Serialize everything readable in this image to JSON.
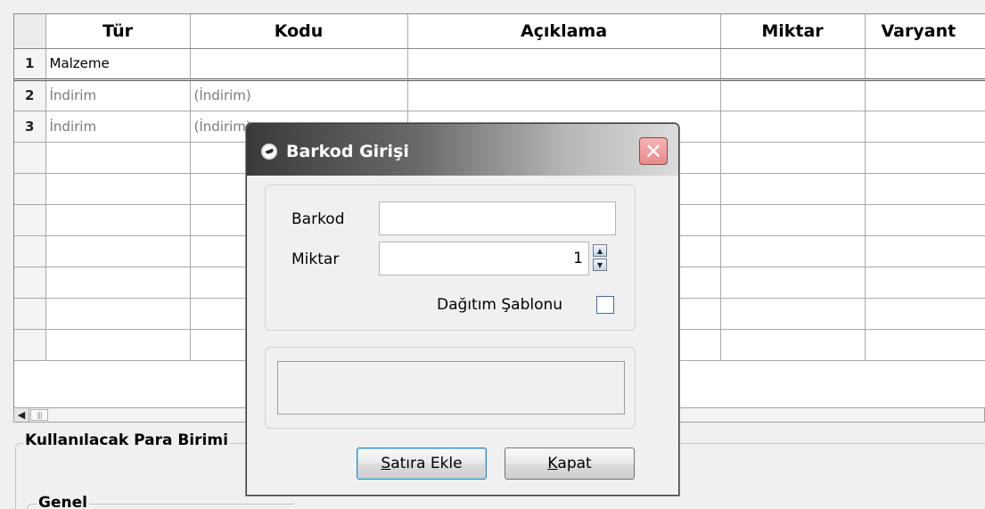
{
  "grid": {
    "columns": [
      "",
      "Tür",
      "Kodu",
      "Açıklama",
      "Miktar",
      "Varyant"
    ],
    "rows": [
      {
        "num": "1",
        "tur": "Malzeme",
        "kodu": "",
        "dim": false
      },
      {
        "num": "2",
        "tur": "İndirim",
        "kodu": "(İndirim)",
        "dim": true
      },
      {
        "num": "3",
        "tur": "İndirim",
        "kodu": "(İndirim)",
        "dim": true
      },
      {
        "num": "",
        "tur": "",
        "kodu": "",
        "dim": false
      },
      {
        "num": "",
        "tur": "",
        "kodu": "",
        "dim": false
      },
      {
        "num": "",
        "tur": "",
        "kodu": "",
        "dim": false
      },
      {
        "num": "",
        "tur": "",
        "kodu": "",
        "dim": false
      },
      {
        "num": "",
        "tur": "",
        "kodu": "",
        "dim": false
      },
      {
        "num": "",
        "tur": "",
        "kodu": "",
        "dim": false
      },
      {
        "num": "",
        "tur": "",
        "kodu": "",
        "dim": false
      }
    ]
  },
  "bottom": {
    "group_title": "Kullanılacak Para Birimi",
    "inner_group_title": "Genel"
  },
  "dialog": {
    "title": "Barkod Girişi",
    "close_glyph": "✕",
    "barkod_label": "Barkod",
    "barkod_value": "",
    "miktar_label": "Miktar",
    "miktar_value": "1",
    "dagitim_label": "Dağıtım Şablonu",
    "dagitim_checked": false,
    "message": "",
    "add_button": {
      "mnemonic": "S",
      "rest": "atıra Ekle"
    },
    "close_button": {
      "mnemonic": "K",
      "rest": "apat"
    }
  },
  "icons": {
    "scroll_left": "scroll-left-arrow-icon",
    "spin_up": "spin-up-icon",
    "spin_down": "spin-down-icon",
    "app": "app-eye-icon"
  },
  "colors": {
    "title_gradient_start": "#3a3a3a",
    "close_button": "#e88a8a",
    "checkbox_border": "#4a6aa0"
  }
}
